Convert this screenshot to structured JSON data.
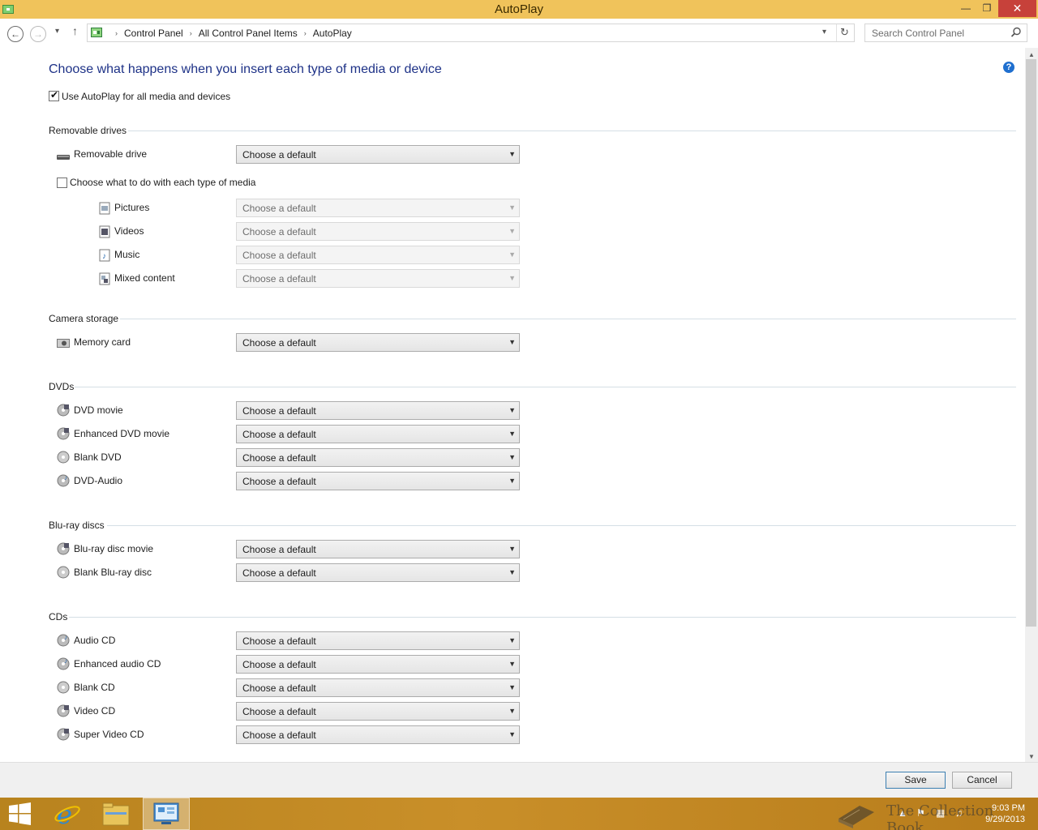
{
  "window": {
    "title": "AutoPlay"
  },
  "titlebar": {
    "minimize": "—",
    "maximize": "❐",
    "close": "✕"
  },
  "nav": {
    "back": "←",
    "forward": "→",
    "recent": "▾",
    "up": "↑",
    "breadcrumb": [
      "Control Panel",
      "All Control Panel Items",
      "AutoPlay"
    ],
    "dropdown": "▾",
    "refresh": "↻",
    "search_placeholder": "Search Control Panel"
  },
  "heading": "Choose what happens when you insert each type of media or device",
  "help": "?",
  "use_autoplay": {
    "label": "Use AutoPlay for all media and devices",
    "checked": true
  },
  "default_value": "Choose a default",
  "sections": {
    "removable": {
      "title": "Removable drives",
      "drive": "Removable drive",
      "media_checkbox": "Choose what to do with each type of media",
      "media": [
        "Pictures",
        "Videos",
        "Music",
        "Mixed content"
      ]
    },
    "camera": {
      "title": "Camera storage",
      "items": [
        "Memory card"
      ]
    },
    "dvds": {
      "title": "DVDs",
      "items": [
        "DVD movie",
        "Enhanced DVD movie",
        "Blank DVD",
        "DVD-Audio"
      ]
    },
    "bluray": {
      "title": "Blu-ray discs",
      "items": [
        "Blu-ray disc movie",
        "Blank Blu-ray disc"
      ]
    },
    "cds": {
      "title": "CDs",
      "items": [
        "Audio CD",
        "Enhanced audio CD",
        "Blank CD",
        "Video CD",
        "Super Video CD"
      ]
    }
  },
  "buttons": {
    "save": "Save",
    "cancel": "Cancel"
  },
  "taskbar": {
    "time": "9:03 PM",
    "date": "9/29/2013",
    "watermark": "The Collection Book"
  },
  "colors": {
    "titlebar": "#f0c35b",
    "heading": "#1e3287",
    "taskbar": "#c98f29",
    "close": "#c7413a"
  }
}
